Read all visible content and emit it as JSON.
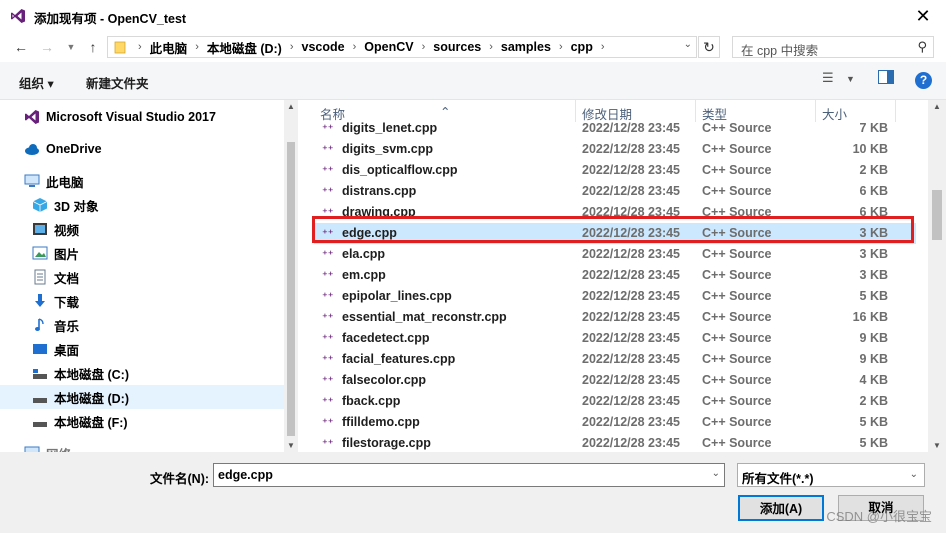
{
  "window": {
    "title": "添加现有项 - OpenCV_test",
    "close": "✕"
  },
  "address": {
    "crumbs": [
      "此电脑",
      "本地磁盘 (D:)",
      "vscode",
      "OpenCV",
      "sources",
      "samples",
      "cpp"
    ],
    "search_placeholder": "在 cpp 中搜索"
  },
  "toolbar": {
    "organize": "组织 ▾",
    "new_folder": "新建文件夹"
  },
  "sidebar": {
    "items": [
      {
        "label": "Microsoft Visual Studio 2017",
        "icon": "visual-studio-icon"
      },
      {
        "label": "OneDrive",
        "icon": "cloud-icon"
      },
      {
        "label": "此电脑",
        "icon": "computer-icon"
      },
      {
        "label": "3D 对象",
        "icon": "3d-objects-icon"
      },
      {
        "label": "视频",
        "icon": "video-icon"
      },
      {
        "label": "图片",
        "icon": "pictures-icon"
      },
      {
        "label": "文档",
        "icon": "documents-icon"
      },
      {
        "label": "下载",
        "icon": "download-icon"
      },
      {
        "label": "音乐",
        "icon": "music-icon"
      },
      {
        "label": "桌面",
        "icon": "desktop-icon"
      },
      {
        "label": "本地磁盘 (C:)",
        "icon": "drive-icon"
      },
      {
        "label": "本地磁盘 (D:)",
        "icon": "drive-icon"
      },
      {
        "label": "本地磁盘 (F:)",
        "icon": "drive-icon"
      },
      {
        "label": "网络",
        "icon": "network-icon"
      }
    ]
  },
  "columns": {
    "name": "名称",
    "date": "修改日期",
    "type": "类型",
    "size": "大小"
  },
  "files": [
    {
      "name": "digits_lenet.cpp",
      "date": "2022/12/28 23:45",
      "type": "C++ Source",
      "size": "7 KB"
    },
    {
      "name": "digits_svm.cpp",
      "date": "2022/12/28 23:45",
      "type": "C++ Source",
      "size": "10 KB"
    },
    {
      "name": "dis_opticalflow.cpp",
      "date": "2022/12/28 23:45",
      "type": "C++ Source",
      "size": "2 KB"
    },
    {
      "name": "distrans.cpp",
      "date": "2022/12/28 23:45",
      "type": "C++ Source",
      "size": "6 KB"
    },
    {
      "name": "drawing.cpp",
      "date": "2022/12/28 23:45",
      "type": "C++ Source",
      "size": "6 KB"
    },
    {
      "name": "edge.cpp",
      "date": "2022/12/28 23:45",
      "type": "C++ Source",
      "size": "3 KB"
    },
    {
      "name": "ela.cpp",
      "date": "2022/12/28 23:45",
      "type": "C++ Source",
      "size": "3 KB"
    },
    {
      "name": "em.cpp",
      "date": "2022/12/28 23:45",
      "type": "C++ Source",
      "size": "3 KB"
    },
    {
      "name": "epipolar_lines.cpp",
      "date": "2022/12/28 23:45",
      "type": "C++ Source",
      "size": "5 KB"
    },
    {
      "name": "essential_mat_reconstr.cpp",
      "date": "2022/12/28 23:45",
      "type": "C++ Source",
      "size": "16 KB"
    },
    {
      "name": "facedetect.cpp",
      "date": "2022/12/28 23:45",
      "type": "C++ Source",
      "size": "9 KB"
    },
    {
      "name": "facial_features.cpp",
      "date": "2022/12/28 23:45",
      "type": "C++ Source",
      "size": "9 KB"
    },
    {
      "name": "falsecolor.cpp",
      "date": "2022/12/28 23:45",
      "type": "C++ Source",
      "size": "4 KB"
    },
    {
      "name": "fback.cpp",
      "date": "2022/12/28 23:45",
      "type": "C++ Source",
      "size": "2 KB"
    },
    {
      "name": "ffilldemo.cpp",
      "date": "2022/12/28 23:45",
      "type": "C++ Source",
      "size": "5 KB"
    },
    {
      "name": "filestorage.cpp",
      "date": "2022/12/28 23:45",
      "type": "C++ Source",
      "size": "5 KB"
    }
  ],
  "selected_file": "edge.cpp",
  "bottom": {
    "filename_label": "文件名(N):",
    "filename_value": "edge.cpp",
    "filetype_value": "所有文件(*.*)",
    "add_label": "添加(A)",
    "cancel_label": "取消",
    "watermark": "CSDN @小很宝宝"
  },
  "colors": {
    "accent": "#0078d7",
    "selection": "#cce8ff",
    "highlight_border": "#e02020",
    "cpp_icon": "#68217a"
  }
}
